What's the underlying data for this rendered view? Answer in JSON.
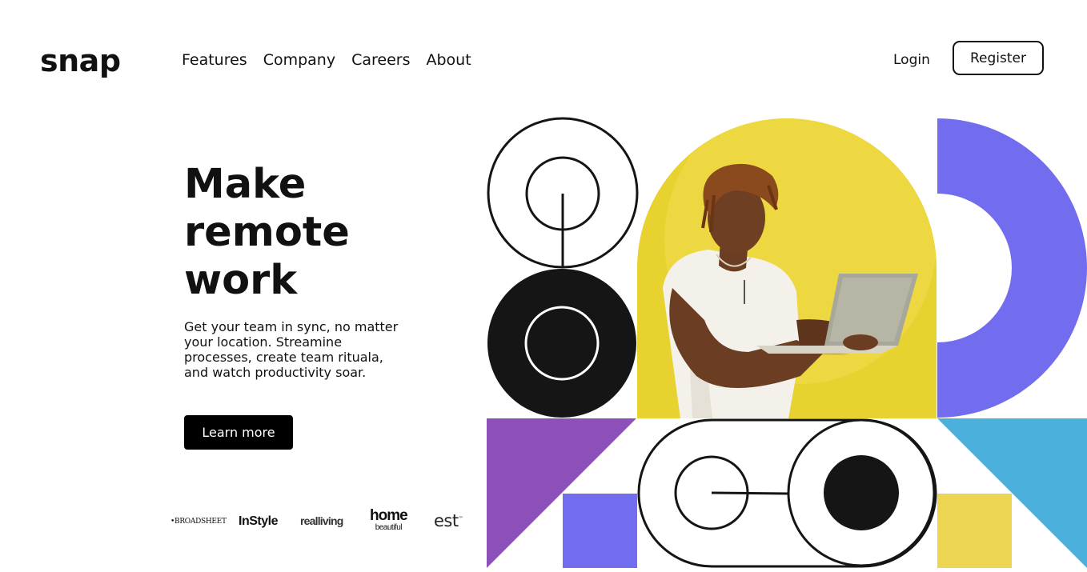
{
  "header": {
    "logo": "snap",
    "nav": [
      "Features",
      "Company",
      "Careers",
      "About"
    ],
    "login": "Login",
    "register": "Register"
  },
  "hero": {
    "headline": [
      "Make",
      "remote",
      "work"
    ],
    "subtext": "Get your team in sync, no matter your location. Streamine processes, create team rituala, and watch productivity soar.",
    "cta": "Learn more"
  },
  "clients": {
    "broadsheet": "BROADSHEET",
    "instyle": "InStyle",
    "realliving": "realliving",
    "home_beautiful": [
      "home",
      "beautiful"
    ],
    "est": "est"
  },
  "colors": {
    "yellow": "#e8d230",
    "indigo": "#726cee",
    "purple": "#8d4fb8",
    "sky": "#4cb0dc",
    "gold": "#ecd553",
    "ink": "#151515"
  },
  "icons": {
    "bullet": "•",
    "trademark": "™"
  }
}
